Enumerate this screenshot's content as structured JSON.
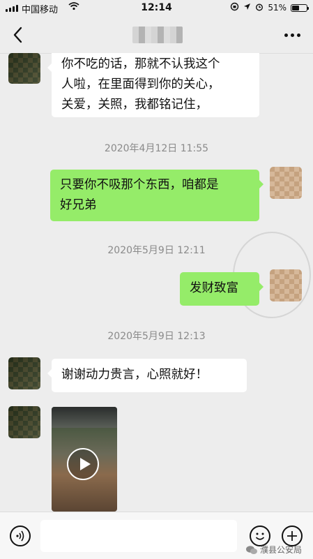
{
  "status_bar": {
    "carrier": "中国移动",
    "time": "12:14",
    "battery_percent_label": "51%",
    "battery_level": 0.51
  },
  "nav": {
    "back_icon": "chevron-left-icon",
    "more_icon": "ellipsis-icon"
  },
  "messages": [
    {
      "side": "in",
      "text_lines": [
        "你不吃的话，那就不认我这个",
        "人啦，在里面得到你的关心，",
        "关爱，关照，我都铭记住，"
      ]
    },
    {
      "type": "timestamp",
      "text": "2020年4月12日 11:55"
    },
    {
      "side": "out",
      "text_lines": [
        "只要你不吸那个东西，咱都是",
        "好兄弟"
      ]
    },
    {
      "type": "timestamp",
      "text": "2020年5月9日 12:11"
    },
    {
      "side": "out",
      "text": "发财致富"
    },
    {
      "type": "timestamp",
      "text": "2020年5月9日 12:13"
    },
    {
      "side": "in",
      "text": "谢谢动力贵言，心照就好！"
    },
    {
      "side": "in",
      "type": "video"
    }
  ],
  "input_bar": {
    "voice_icon": "voice-icon",
    "emoji_icon": "emoji-icon",
    "add_icon": "plus-icon",
    "input_value": ""
  },
  "watermark": {
    "icon": "wechat-icon",
    "text": "濮县公安局"
  },
  "colors": {
    "outgoing_bubble": "#95ec69",
    "incoming_bubble": "#ffffff",
    "background": "#ededed"
  }
}
